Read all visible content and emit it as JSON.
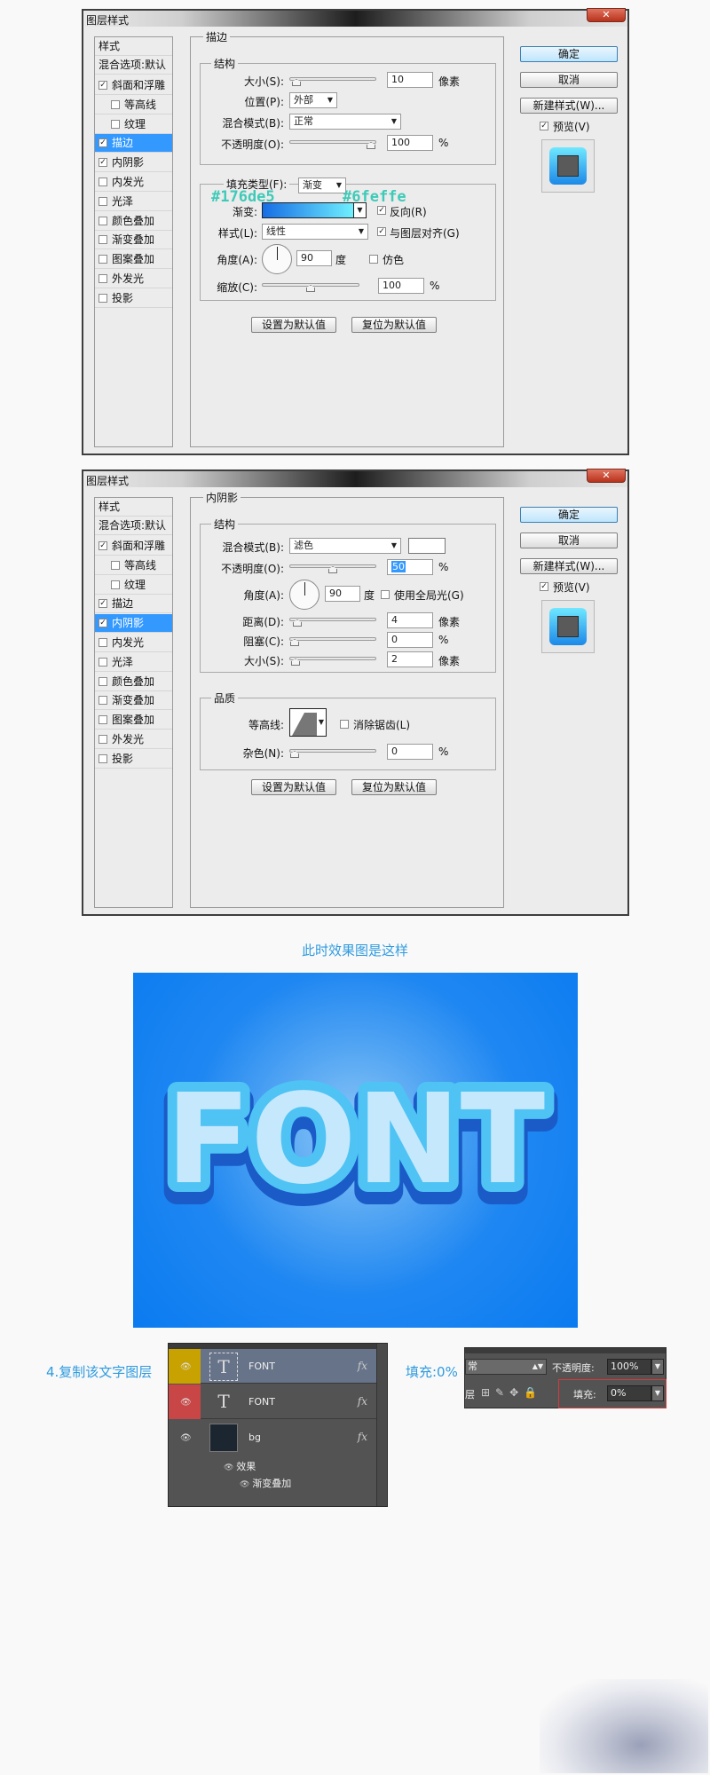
{
  "dialog1": {
    "title": "图层样式",
    "close": "✕",
    "styles_header": "样式",
    "blend_default": "混合选项:默认",
    "items": [
      {
        "label": "斜面和浮雕",
        "checked": true,
        "indent": false,
        "selected": false
      },
      {
        "label": "等高线",
        "checked": false,
        "indent": true,
        "selected": false
      },
      {
        "label": "纹理",
        "checked": false,
        "indent": true,
        "selected": false
      },
      {
        "label": "描边",
        "checked": true,
        "indent": false,
        "selected": true
      },
      {
        "label": "内阴影",
        "checked": true,
        "indent": false,
        "selected": false
      },
      {
        "label": "内发光",
        "checked": false,
        "indent": false,
        "selected": false
      },
      {
        "label": "光泽",
        "checked": false,
        "indent": false,
        "selected": false
      },
      {
        "label": "颜色叠加",
        "checked": false,
        "indent": false,
        "selected": false
      },
      {
        "label": "渐变叠加",
        "checked": false,
        "indent": false,
        "selected": false
      },
      {
        "label": "图案叠加",
        "checked": false,
        "indent": false,
        "selected": false
      },
      {
        "label": "外发光",
        "checked": false,
        "indent": false,
        "selected": false
      },
      {
        "label": "投影",
        "checked": false,
        "indent": false,
        "selected": false
      }
    ],
    "section": "描边",
    "structure": "结构",
    "size_label": "大小(S):",
    "size_value": "10",
    "size_unit": "像素",
    "size_level": 0.02,
    "position_label": "位置(P):",
    "position_value": "外部",
    "blend_label": "混合模式(B):",
    "blend_value": "正常",
    "opacity_label": "不透明度(O):",
    "opacity_value": "100",
    "opacity_unit": "%",
    "opacity_level": 1.0,
    "fill_type_label": "填充类型(F):",
    "fill_type_value": "渐变",
    "gradient_label": "渐变:",
    "reverse_label": "反向(R)",
    "style_label": "样式(L):",
    "style_value": "线性",
    "align_label": "与图层对齐(G)",
    "angle_label": "角度(A):",
    "angle_value": "90",
    "angle_unit": "度",
    "dither_label": "仿色",
    "scale_label": "缩放(C):",
    "scale_value": "100",
    "scale_unit": "%",
    "scale_level": 0.5,
    "set_default": "设置为默认值",
    "reset_default": "复位为默认值",
    "ok": "确定",
    "cancel": "取消",
    "new_style": "新建样式(W)...",
    "preview": "预览(V)",
    "hex_start": "#176de5",
    "hex_end": "#6feffe"
  },
  "dialog2": {
    "title": "图层样式",
    "close": "✕",
    "styles_header": "样式",
    "blend_default": "混合选项:默认",
    "items": [
      {
        "label": "斜面和浮雕",
        "checked": true,
        "indent": false,
        "selected": false
      },
      {
        "label": "等高线",
        "checked": false,
        "indent": true,
        "selected": false
      },
      {
        "label": "纹理",
        "checked": false,
        "indent": true,
        "selected": false
      },
      {
        "label": "描边",
        "checked": true,
        "indent": false,
        "selected": false
      },
      {
        "label": "内阴影",
        "checked": true,
        "indent": false,
        "selected": true
      },
      {
        "label": "内发光",
        "checked": false,
        "indent": false,
        "selected": false
      },
      {
        "label": "光泽",
        "checked": false,
        "indent": false,
        "selected": false
      },
      {
        "label": "颜色叠加",
        "checked": false,
        "indent": false,
        "selected": false
      },
      {
        "label": "渐变叠加",
        "checked": false,
        "indent": false,
        "selected": false
      },
      {
        "label": "图案叠加",
        "checked": false,
        "indent": false,
        "selected": false
      },
      {
        "label": "外发光",
        "checked": false,
        "indent": false,
        "selected": false
      },
      {
        "label": "投影",
        "checked": false,
        "indent": false,
        "selected": false
      }
    ],
    "section": "内阴影",
    "structure": "结构",
    "blend_label": "混合模式(B):",
    "blend_value": "滤色",
    "opacity_label": "不透明度(O):",
    "opacity_value": "50",
    "opacity_unit": "%",
    "opacity_level": 0.5,
    "angle_label": "角度(A):",
    "angle_value": "90",
    "angle_unit": "度",
    "global_light_label": "使用全局光(G)",
    "distance_label": "距离(D):",
    "distance_value": "4",
    "distance_unit": "像素",
    "distance_level": 0.03,
    "choke_label": "阻塞(C):",
    "choke_value": "0",
    "choke_unit": "%",
    "choke_level": 0.0,
    "size_label": "大小(S):",
    "size_value": "2",
    "size_unit": "像素",
    "size_level": 0.01,
    "quality": "品质",
    "contour_label": "等高线:",
    "antialias_label": "消除锯齿(L)",
    "noise_label": "杂色(N):",
    "noise_value": "0",
    "noise_unit": "%",
    "noise_level": 0.0,
    "set_default": "设置为默认值",
    "reset_default": "复位为默认值",
    "ok": "确定",
    "cancel": "取消",
    "new_style": "新建样式(W)...",
    "preview": "预览(V)"
  },
  "result_caption": "此时效果图是这样",
  "result_text": "FONT",
  "step4_text": "4.复制该文字图层",
  "fill_caption": "填充:0%",
  "layers": {
    "rows": [
      {
        "name": "FONT",
        "fx": "fx",
        "color": "#c8a200",
        "selected": true
      },
      {
        "name": "FONT",
        "fx": "fx",
        "color": "#c94646",
        "selected": false
      }
    ],
    "bg_name": "bg",
    "bg_fx": "fx",
    "effects_label": "效果",
    "gradient_overlay_label": "渐变叠加"
  },
  "options": {
    "blend": "常",
    "opacity_label": "不透明度:",
    "opacity_value": "100%",
    "lock_label": "层",
    "fill_label": "填充:",
    "fill_value": "0%"
  }
}
